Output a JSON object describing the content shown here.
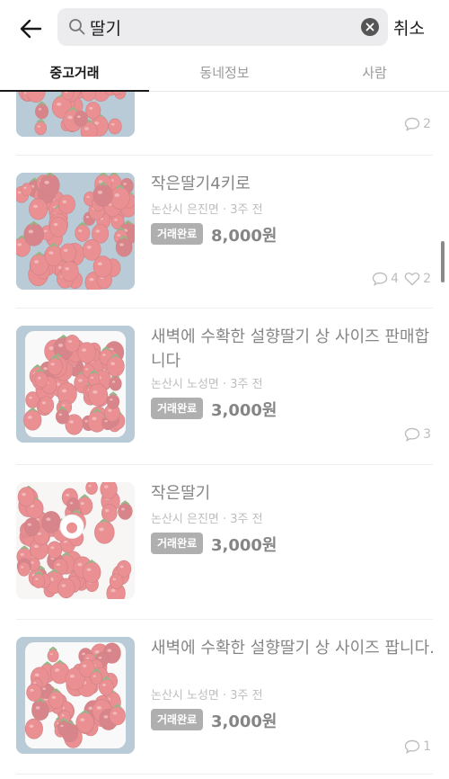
{
  "search": {
    "query": "딸기",
    "cancel_label": "취소"
  },
  "tabs": [
    {
      "label": "중고거래",
      "active": true
    },
    {
      "label": "동네정보",
      "active": false
    },
    {
      "label": "사람",
      "active": false
    }
  ],
  "items": [
    {
      "title": "",
      "location": "",
      "badge": "",
      "price": "",
      "comments": "2",
      "likes": ""
    },
    {
      "title": "작은딸기4키로",
      "location": "논산시 은진면 · 3주 전",
      "badge": "거래완료",
      "price": "8,000원",
      "comments": "4",
      "likes": "2"
    },
    {
      "title": "새벽에 수확한 설향딸기 상 사이즈 판매합니다",
      "location": "논산시 노성면 · 3주 전",
      "badge": "거래완료",
      "price": "3,000원",
      "comments": "3",
      "likes": ""
    },
    {
      "title": "작은딸기",
      "location": "논산시 은진면 · 3주 전",
      "badge": "거래완료",
      "price": "3,000원",
      "comments": "",
      "likes": ""
    },
    {
      "title": "새벽에 수확한 설향딸기 상 사이즈 팝니다.",
      "location": "논산시 노성면 · 3주 전",
      "badge": "거래완료",
      "price": "3,000원",
      "comments": "1",
      "likes": ""
    }
  ],
  "colors": {
    "accent": "#1a1a1a",
    "badge": "#6e6e6e",
    "strawberry": "#d9343a",
    "background": "#ffffff"
  },
  "icons": {
    "back": "arrow-left-icon",
    "search": "magnifier-icon",
    "clear": "close-circle-icon",
    "comment": "chat-bubble-icon",
    "like": "heart-icon"
  }
}
